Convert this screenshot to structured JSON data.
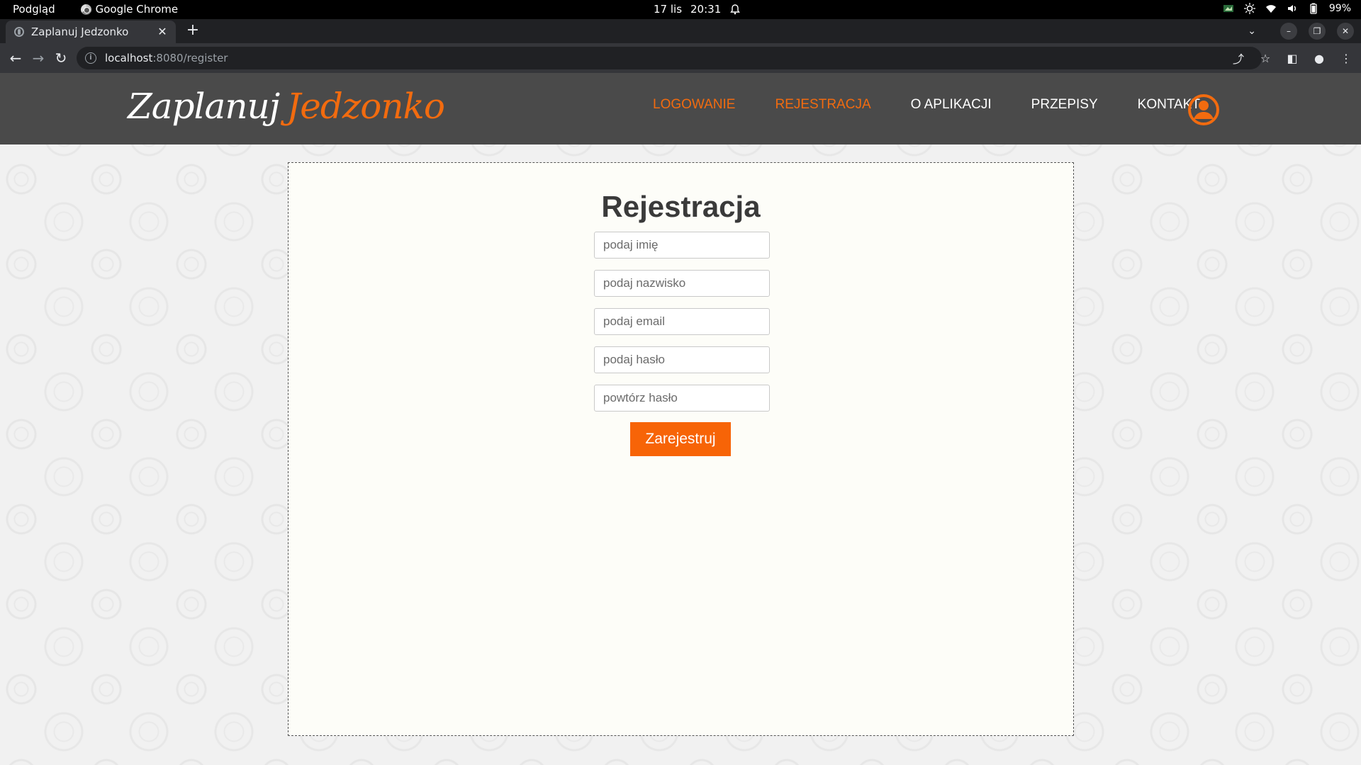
{
  "os": {
    "app_menu": "Podgląd",
    "active_app": "Google Chrome",
    "date": "17 lis",
    "time": "20:31",
    "battery": "99%"
  },
  "browser": {
    "tab_title": "Zaplanuj Jedzonko",
    "url_host": "localhost",
    "url_path": ":8080/register"
  },
  "site": {
    "logo_part1": "Zaplanuj",
    "logo_part2": "Jedzonko",
    "nav": [
      {
        "label": "LOGOWANIE",
        "active": true
      },
      {
        "label": "REJESTRACJA",
        "active": true
      },
      {
        "label": "O APLIKACJI",
        "active": false
      },
      {
        "label": "PRZEPISY",
        "active": false
      },
      {
        "label": "KONTAKT",
        "active": false
      }
    ],
    "accent_color": "#f26b0f"
  },
  "form": {
    "title": "Rejestracja",
    "fields": [
      {
        "placeholder": "podaj imię",
        "value": ""
      },
      {
        "placeholder": "podaj nazwisko",
        "value": ""
      },
      {
        "placeholder": "podaj email",
        "value": ""
      },
      {
        "placeholder": "podaj hasło",
        "value": ""
      },
      {
        "placeholder": "powtórz hasło",
        "value": ""
      }
    ],
    "submit_label": "Zarejestruj"
  }
}
